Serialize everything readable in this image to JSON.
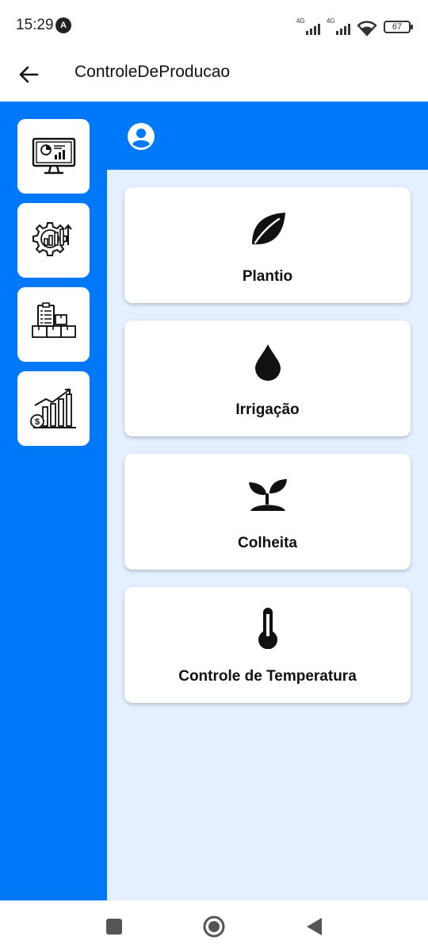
{
  "status_bar": {
    "time": "15:29",
    "app_badge": "A",
    "network_1": "4G",
    "network_2": "4G",
    "battery": "67"
  },
  "app_bar": {
    "title": "ControleDeProducao",
    "back_icon": "arrow-left-icon"
  },
  "sidebar": {
    "items": [
      {
        "icon": "monitor-chart-icon"
      },
      {
        "icon": "gear-growth-icon"
      },
      {
        "icon": "inventory-boxes-icon"
      },
      {
        "icon": "money-growth-chart-icon"
      }
    ]
  },
  "header": {
    "icon": "user-circle-icon"
  },
  "cards": [
    {
      "label": "Plantio",
      "icon": "leaf-icon"
    },
    {
      "label": "Irrigação",
      "icon": "water-drop-icon"
    },
    {
      "label": "Colheita",
      "icon": "sprout-icon"
    },
    {
      "label": "Controle de Temperatura",
      "icon": "thermometer-icon"
    }
  ],
  "nav_bar": {
    "items": [
      "recents-square-icon",
      "home-circle-icon",
      "back-triangle-icon"
    ]
  },
  "colors": {
    "primary": "#0078fa",
    "content_bg": "#e4efff",
    "card_bg": "#ffffff",
    "text": "#111111"
  }
}
